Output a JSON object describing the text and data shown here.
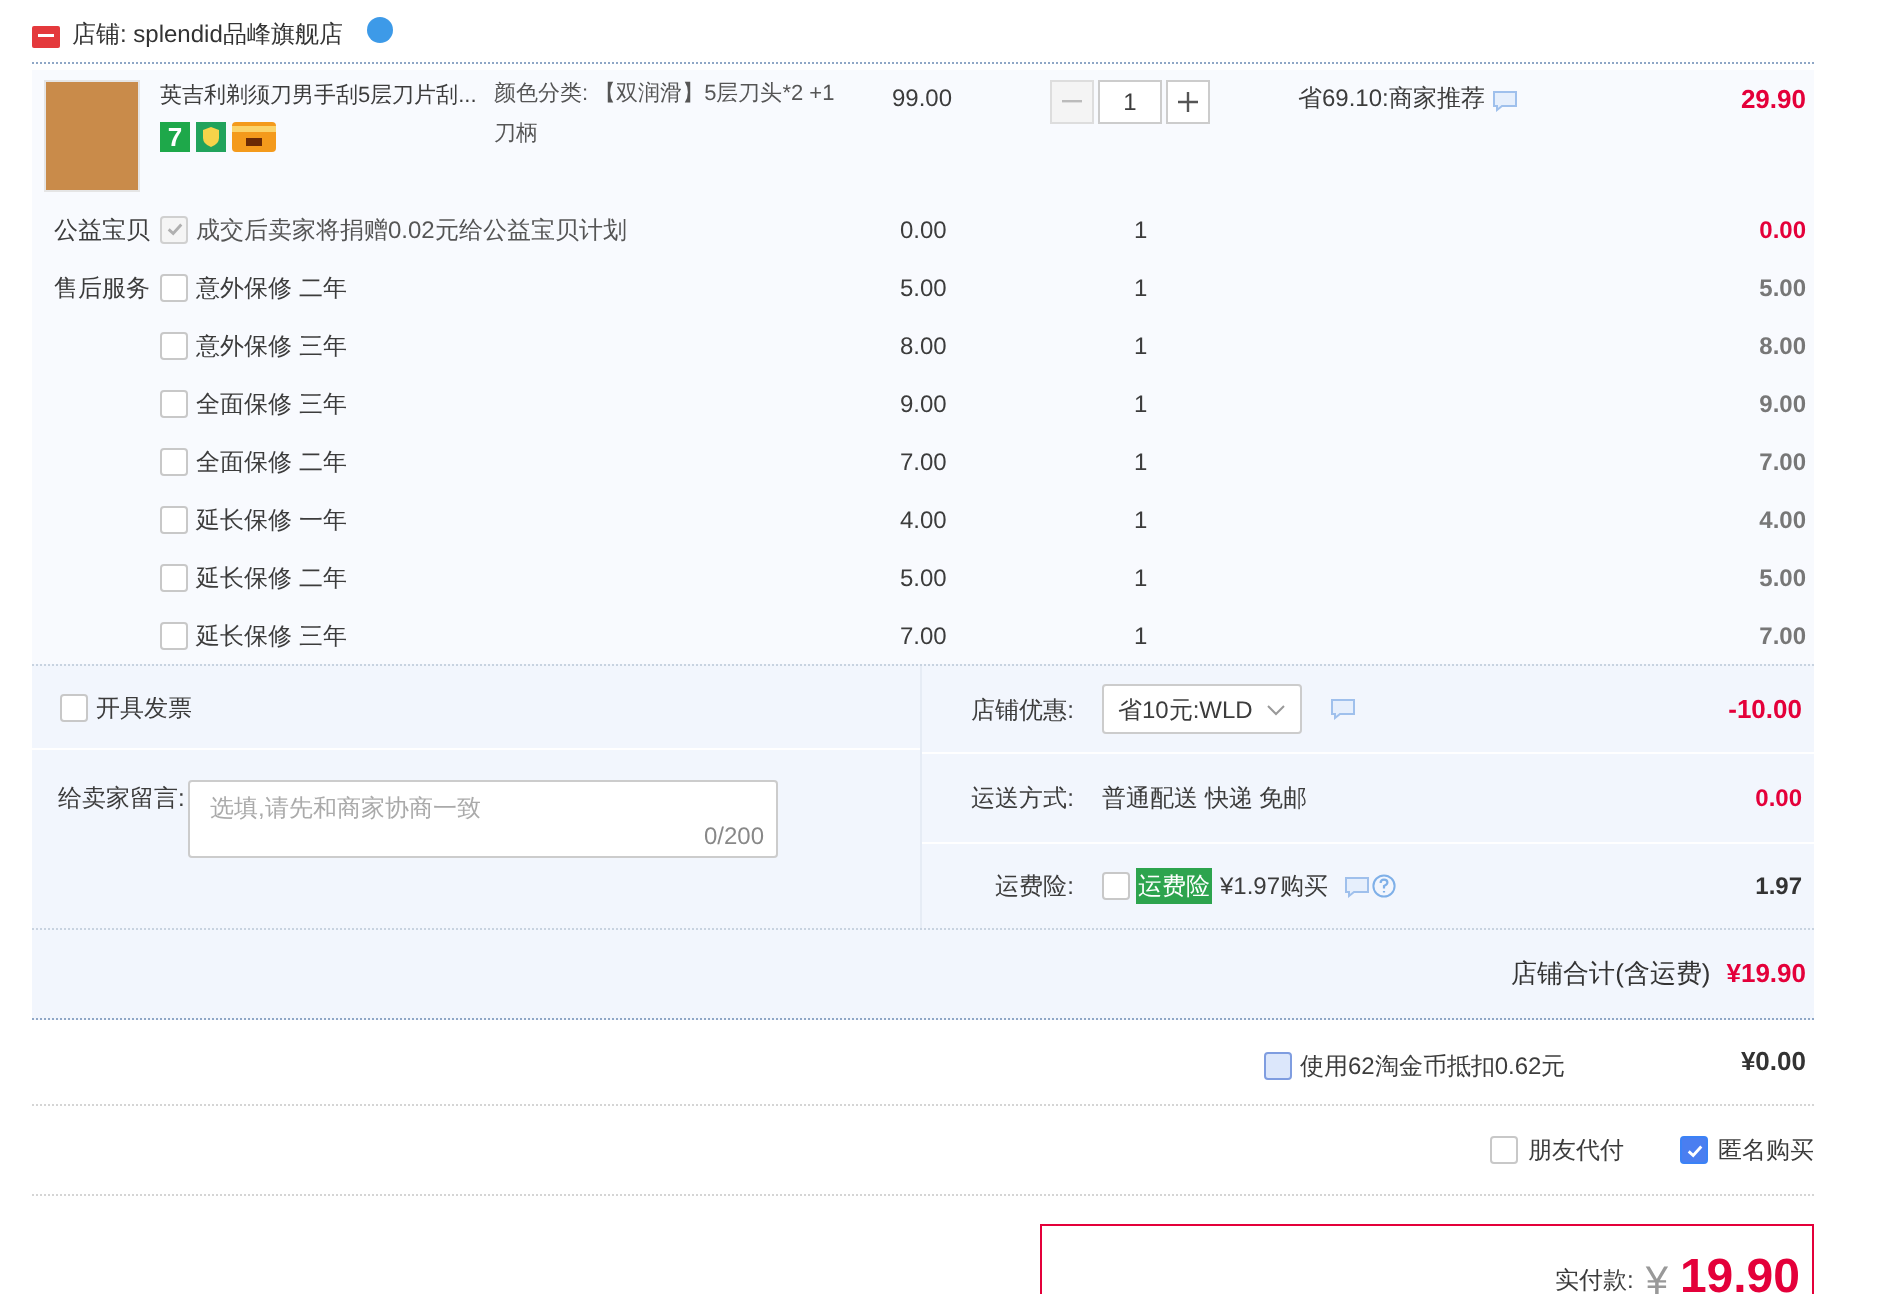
{
  "shop": {
    "label": "店铺: splendid品峰旗舰店"
  },
  "product": {
    "name": "英吉利剃须刀男手刮5层刀片刮...",
    "badges": [
      {
        "kind": "days",
        "text": "7"
      },
      {
        "kind": "shield"
      },
      {
        "kind": "card"
      }
    ],
    "spec": "颜色分类: 【双润滑】5层刀头*2 +1刀柄",
    "price": "99.00",
    "quantity": "1",
    "discount": "省69.10:商家推荐",
    "total": "29.90"
  },
  "services": [
    {
      "kind": "charity",
      "label": "公益宝贝",
      "checked": true,
      "disabled": true,
      "name": "成交后卖家将捐赠0.02元给公益宝贝计划",
      "price": "0.00",
      "quantity": "1",
      "total": "0.00"
    },
    {
      "kind": "service",
      "label": "售后服务",
      "checked": false,
      "disabled": false,
      "name": "意外保修 二年",
      "price": "5.00",
      "quantity": "1",
      "total": "5.00"
    },
    {
      "kind": "service",
      "checked": false,
      "disabled": false,
      "name": "意外保修 三年",
      "price": "8.00",
      "quantity": "1",
      "total": "8.00"
    },
    {
      "kind": "service",
      "checked": false,
      "disabled": false,
      "name": "全面保修 三年",
      "price": "9.00",
      "quantity": "1",
      "total": "9.00"
    },
    {
      "kind": "service",
      "checked": false,
      "disabled": false,
      "name": "全面保修 二年",
      "price": "7.00",
      "quantity": "1",
      "total": "7.00"
    },
    {
      "kind": "service",
      "checked": false,
      "disabled": false,
      "name": "延长保修 一年",
      "price": "4.00",
      "quantity": "1",
      "total": "4.00"
    },
    {
      "kind": "service",
      "checked": false,
      "disabled": false,
      "name": "延长保修 二年",
      "price": "5.00",
      "quantity": "1",
      "total": "5.00"
    },
    {
      "kind": "service",
      "checked": false,
      "disabled": false,
      "name": "延长保修 三年",
      "price": "7.00",
      "quantity": "1",
      "total": "7.00"
    }
  ],
  "invoice": {
    "label": "开具发票",
    "checked": false
  },
  "message": {
    "label": "给卖家留言:",
    "placeholder": "选填,请先和商家协商一致",
    "counter": "0/200"
  },
  "coupon": {
    "label": "店铺优惠:",
    "value": "省10元:WLD",
    "amount": "-10.00"
  },
  "shipping": {
    "label": "运送方式:",
    "value": "普通配送 快递 免邮",
    "amount": "0.00"
  },
  "insurance": {
    "label": "运费险:",
    "checked": false,
    "tag": "运费险",
    "price": "¥1.97购买",
    "amount": "1.97"
  },
  "shop_total": {
    "label": "店铺合计(含运费)",
    "amount": "¥19.90"
  },
  "coins": {
    "label": "使用62淘金币抵扣0.62元",
    "checked": false,
    "amount": "¥0.00"
  },
  "options": [
    {
      "label": "朋友代付",
      "checked": false
    },
    {
      "label": "匿名购买",
      "checked": true
    }
  ],
  "payment": {
    "label": "实付款:",
    "currency": "¥",
    "amount": "19.90"
  }
}
